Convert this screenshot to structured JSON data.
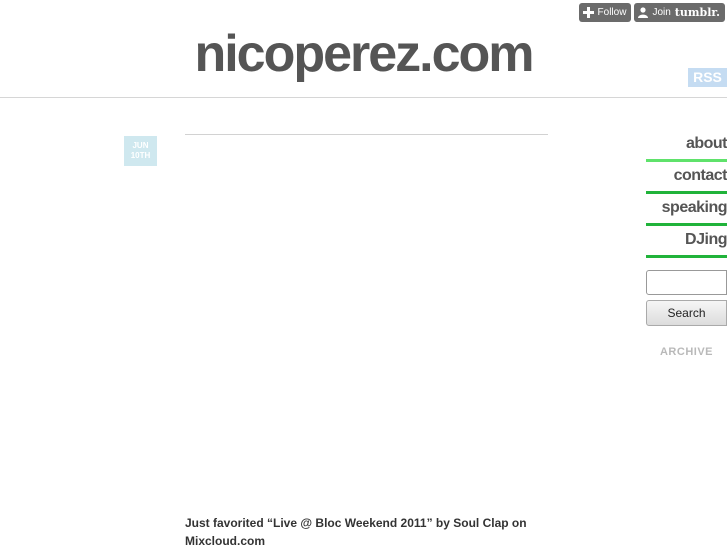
{
  "toolbar": {
    "follow_label": "Follow",
    "join_label": "Join",
    "brand_label": "tumblr.",
    "plus_icon": "plus-icon",
    "person_icon": "person-icon"
  },
  "header": {
    "site_title": "nicoperez.com",
    "rss_label": "RSS"
  },
  "post": {
    "date_month": "JUN",
    "date_day": "10TH",
    "text": "Just favorited “Live @ Bloc Weekend 2011” by Soul Clap on Mixcloud.com"
  },
  "sidebar": {
    "nav": [
      {
        "label": "about"
      },
      {
        "label": "contact"
      },
      {
        "label": "speaking"
      },
      {
        "label": "DJing"
      }
    ],
    "search_value": "",
    "search_button_label": "Search",
    "archive_label": "ARCHIVE"
  },
  "colors": {
    "nav_underline": "#20b33a",
    "nav_underline_first": "#5fe26b",
    "rss_bg": "#c5dcf2",
    "date_badge_bg": "#cfe8ef",
    "title_text": "#555555",
    "tumblr_button_bg": "#6b6b6b"
  }
}
